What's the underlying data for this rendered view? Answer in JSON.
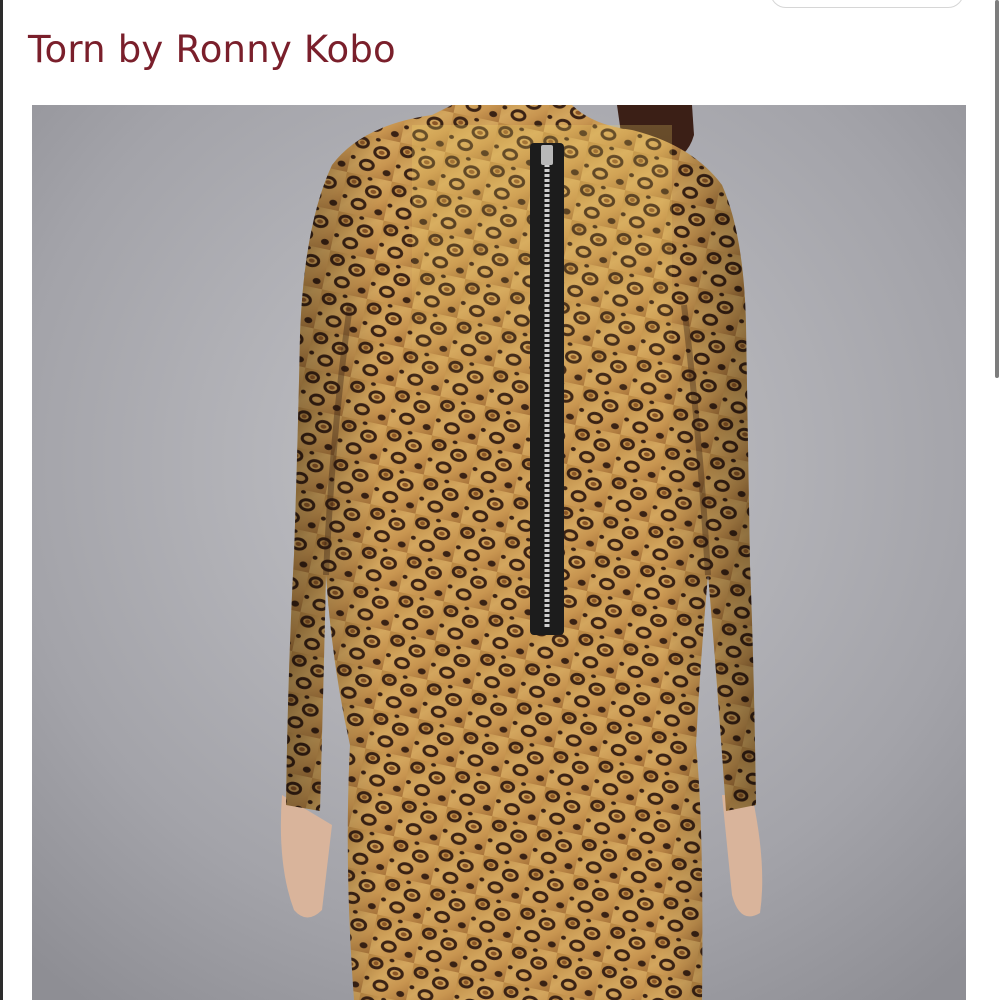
{
  "listing": {
    "title": "Torn by Ronny Kobo"
  },
  "photo": {
    "subject": "back view of leopard print long sleeve dress with exposed back zipper",
    "alt": "Torn by Ronny Kobo"
  },
  "colors": {
    "title": "#7a1f2b",
    "background": "#ffffff",
    "photo_backdrop": "#a2a2a8",
    "leopard_base": "#c99a55",
    "leopard_spot": "#3a2214",
    "zipper": "#1c1c1c",
    "zipper_teeth": "#cfcfcf"
  },
  "icons": {
    "header_pill": "search-pill",
    "scroll": "scrollbar-thumb"
  }
}
